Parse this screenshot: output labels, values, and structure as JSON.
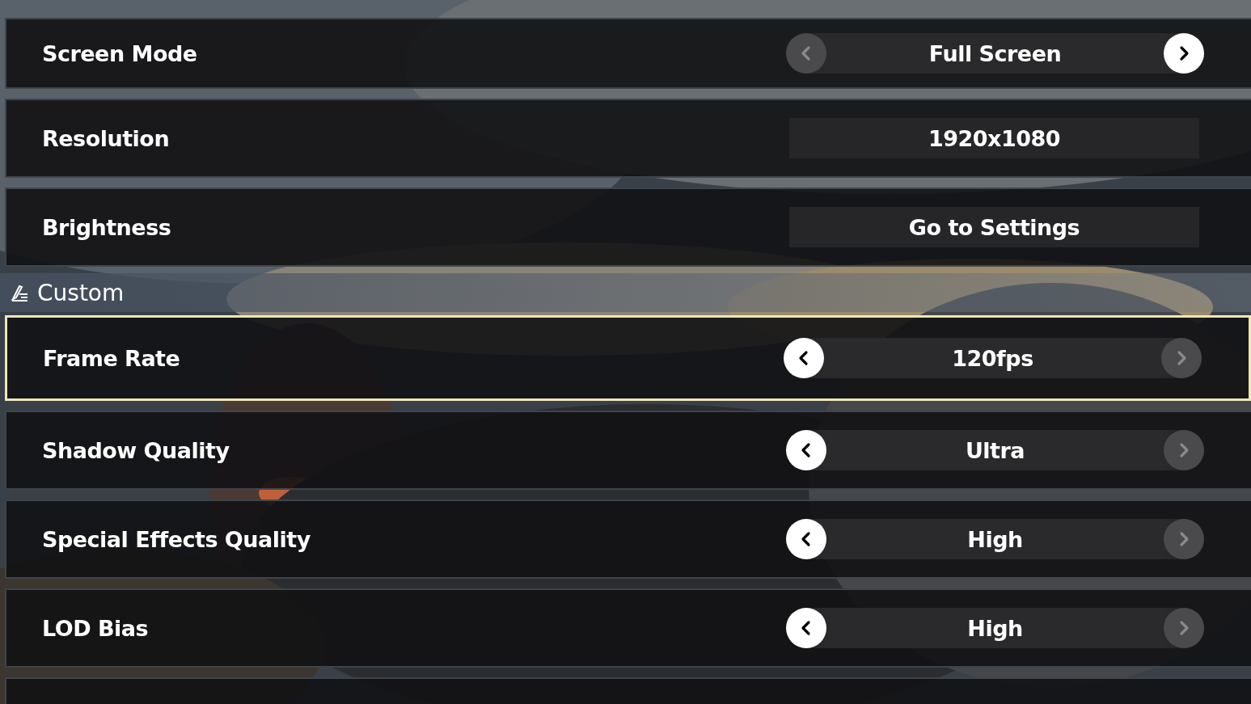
{
  "settings": [
    {
      "kind": "selector",
      "label": "Screen Mode",
      "value": "Full Screen",
      "prev_enabled": false,
      "next_enabled": true,
      "selected": false
    },
    {
      "kind": "value",
      "label": "Resolution",
      "value": "1920x1080",
      "selected": false
    },
    {
      "kind": "link",
      "label": "Brightness",
      "value": "Go to Settings",
      "selected": false
    }
  ],
  "section": {
    "title": "Custom"
  },
  "custom_settings": [
    {
      "kind": "selector",
      "label": "Frame Rate",
      "value": "120fps",
      "prev_enabled": true,
      "next_enabled": false,
      "selected": true
    },
    {
      "kind": "selector",
      "label": "Shadow Quality",
      "value": "Ultra",
      "prev_enabled": true,
      "next_enabled": false,
      "selected": false
    },
    {
      "kind": "selector",
      "label": "Special Effects Quality",
      "value": "High",
      "prev_enabled": true,
      "next_enabled": false,
      "selected": false
    },
    {
      "kind": "selector",
      "label": "LOD Bias",
      "value": "High",
      "prev_enabled": true,
      "next_enabled": false,
      "selected": false
    }
  ]
}
